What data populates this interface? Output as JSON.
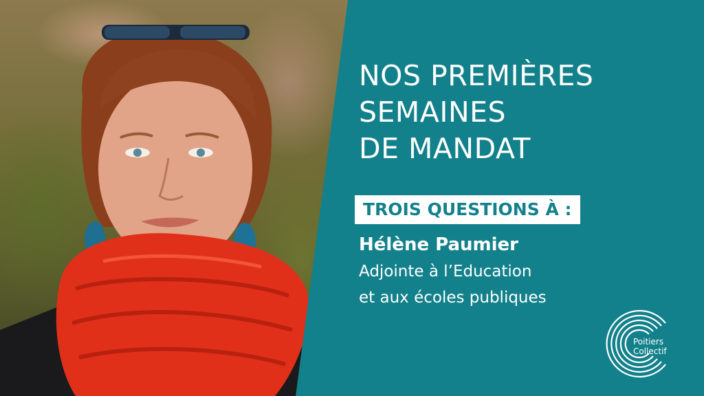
{
  "title_lines": [
    "NOS PREMIÈRES",
    "SEMAINES",
    "DE MANDAT"
  ],
  "badge": "TROIS QUESTIONS À :",
  "person": {
    "name": "Hélène Paumier",
    "role_line_1": "Adjointe à l’Education",
    "role_line_2": "et aux écoles publiques"
  },
  "logo": {
    "line_1": "Poitiers",
    "line_2": "Collectif"
  },
  "colors": {
    "background": "#13818b",
    "text": "#ffffff",
    "badge_background": "#ffffff",
    "badge_text": "#13818b",
    "scarf": "#e0301a"
  },
  "icons": [
    "poitiers-collectif-logo-icon"
  ]
}
